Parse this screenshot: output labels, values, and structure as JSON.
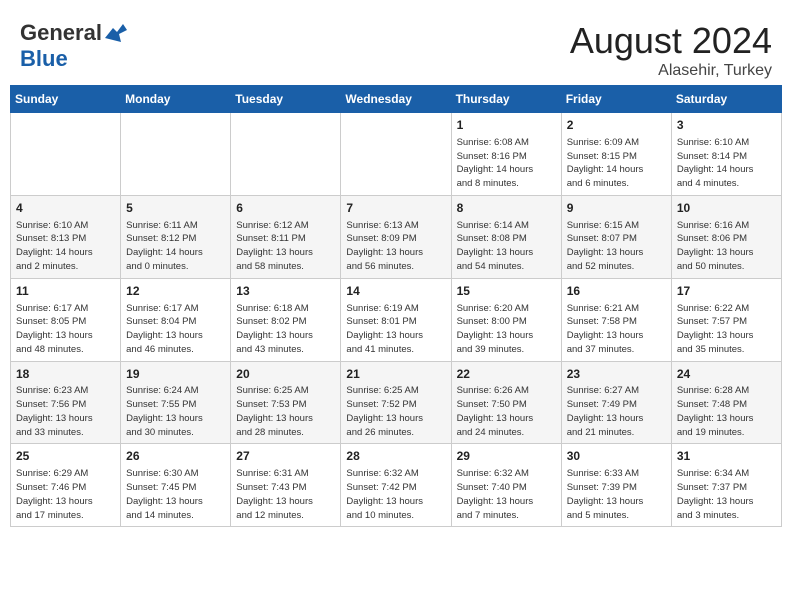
{
  "logo": {
    "line1": "General",
    "line2": "Blue"
  },
  "title": "August 2024",
  "subtitle": "Alasehir, Turkey",
  "weekdays": [
    "Sunday",
    "Monday",
    "Tuesday",
    "Wednesday",
    "Thursday",
    "Friday",
    "Saturday"
  ],
  "weeks": [
    [
      {
        "day": "",
        "info": ""
      },
      {
        "day": "",
        "info": ""
      },
      {
        "day": "",
        "info": ""
      },
      {
        "day": "",
        "info": ""
      },
      {
        "day": "1",
        "info": "Sunrise: 6:08 AM\nSunset: 8:16 PM\nDaylight: 14 hours\nand 8 minutes."
      },
      {
        "day": "2",
        "info": "Sunrise: 6:09 AM\nSunset: 8:15 PM\nDaylight: 14 hours\nand 6 minutes."
      },
      {
        "day": "3",
        "info": "Sunrise: 6:10 AM\nSunset: 8:14 PM\nDaylight: 14 hours\nand 4 minutes."
      }
    ],
    [
      {
        "day": "4",
        "info": "Sunrise: 6:10 AM\nSunset: 8:13 PM\nDaylight: 14 hours\nand 2 minutes."
      },
      {
        "day": "5",
        "info": "Sunrise: 6:11 AM\nSunset: 8:12 PM\nDaylight: 14 hours\nand 0 minutes."
      },
      {
        "day": "6",
        "info": "Sunrise: 6:12 AM\nSunset: 8:11 PM\nDaylight: 13 hours\nand 58 minutes."
      },
      {
        "day": "7",
        "info": "Sunrise: 6:13 AM\nSunset: 8:09 PM\nDaylight: 13 hours\nand 56 minutes."
      },
      {
        "day": "8",
        "info": "Sunrise: 6:14 AM\nSunset: 8:08 PM\nDaylight: 13 hours\nand 54 minutes."
      },
      {
        "day": "9",
        "info": "Sunrise: 6:15 AM\nSunset: 8:07 PM\nDaylight: 13 hours\nand 52 minutes."
      },
      {
        "day": "10",
        "info": "Sunrise: 6:16 AM\nSunset: 8:06 PM\nDaylight: 13 hours\nand 50 minutes."
      }
    ],
    [
      {
        "day": "11",
        "info": "Sunrise: 6:17 AM\nSunset: 8:05 PM\nDaylight: 13 hours\nand 48 minutes."
      },
      {
        "day": "12",
        "info": "Sunrise: 6:17 AM\nSunset: 8:04 PM\nDaylight: 13 hours\nand 46 minutes."
      },
      {
        "day": "13",
        "info": "Sunrise: 6:18 AM\nSunset: 8:02 PM\nDaylight: 13 hours\nand 43 minutes."
      },
      {
        "day": "14",
        "info": "Sunrise: 6:19 AM\nSunset: 8:01 PM\nDaylight: 13 hours\nand 41 minutes."
      },
      {
        "day": "15",
        "info": "Sunrise: 6:20 AM\nSunset: 8:00 PM\nDaylight: 13 hours\nand 39 minutes."
      },
      {
        "day": "16",
        "info": "Sunrise: 6:21 AM\nSunset: 7:58 PM\nDaylight: 13 hours\nand 37 minutes."
      },
      {
        "day": "17",
        "info": "Sunrise: 6:22 AM\nSunset: 7:57 PM\nDaylight: 13 hours\nand 35 minutes."
      }
    ],
    [
      {
        "day": "18",
        "info": "Sunrise: 6:23 AM\nSunset: 7:56 PM\nDaylight: 13 hours\nand 33 minutes."
      },
      {
        "day": "19",
        "info": "Sunrise: 6:24 AM\nSunset: 7:55 PM\nDaylight: 13 hours\nand 30 minutes."
      },
      {
        "day": "20",
        "info": "Sunrise: 6:25 AM\nSunset: 7:53 PM\nDaylight: 13 hours\nand 28 minutes."
      },
      {
        "day": "21",
        "info": "Sunrise: 6:25 AM\nSunset: 7:52 PM\nDaylight: 13 hours\nand 26 minutes."
      },
      {
        "day": "22",
        "info": "Sunrise: 6:26 AM\nSunset: 7:50 PM\nDaylight: 13 hours\nand 24 minutes."
      },
      {
        "day": "23",
        "info": "Sunrise: 6:27 AM\nSunset: 7:49 PM\nDaylight: 13 hours\nand 21 minutes."
      },
      {
        "day": "24",
        "info": "Sunrise: 6:28 AM\nSunset: 7:48 PM\nDaylight: 13 hours\nand 19 minutes."
      }
    ],
    [
      {
        "day": "25",
        "info": "Sunrise: 6:29 AM\nSunset: 7:46 PM\nDaylight: 13 hours\nand 17 minutes."
      },
      {
        "day": "26",
        "info": "Sunrise: 6:30 AM\nSunset: 7:45 PM\nDaylight: 13 hours\nand 14 minutes."
      },
      {
        "day": "27",
        "info": "Sunrise: 6:31 AM\nSunset: 7:43 PM\nDaylight: 13 hours\nand 12 minutes."
      },
      {
        "day": "28",
        "info": "Sunrise: 6:32 AM\nSunset: 7:42 PM\nDaylight: 13 hours\nand 10 minutes."
      },
      {
        "day": "29",
        "info": "Sunrise: 6:32 AM\nSunset: 7:40 PM\nDaylight: 13 hours\nand 7 minutes."
      },
      {
        "day": "30",
        "info": "Sunrise: 6:33 AM\nSunset: 7:39 PM\nDaylight: 13 hours\nand 5 minutes."
      },
      {
        "day": "31",
        "info": "Sunrise: 6:34 AM\nSunset: 7:37 PM\nDaylight: 13 hours\nand 3 minutes."
      }
    ]
  ]
}
